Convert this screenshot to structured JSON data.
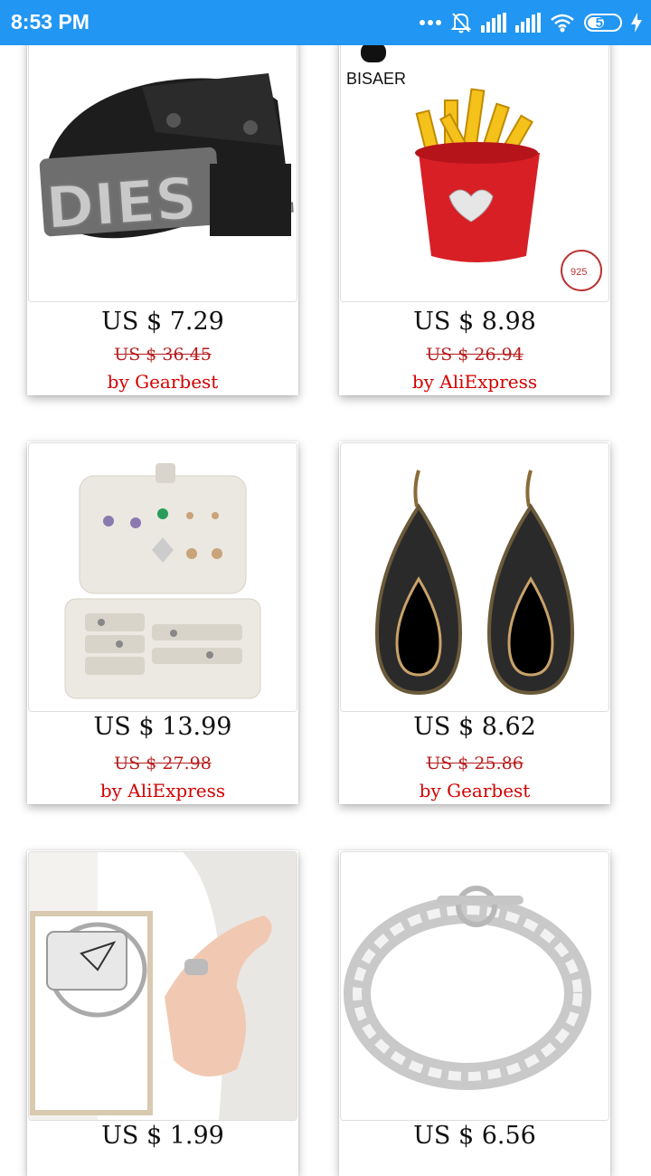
{
  "status_bar": {
    "time": "8:53 PM",
    "battery": "57",
    "battery_level": 0.57,
    "icons": [
      "more-dots-icon",
      "dnd-off-icon",
      "signal-icon",
      "signal-icon",
      "wifi-icon",
      "battery-icon",
      "charging-icon"
    ]
  },
  "products": [
    {
      "price": "US $ 7.29",
      "old_price": "US $ 36.45",
      "seller": "by Gearbest",
      "image": "leather-bracelet-image",
      "image_text": "DIES EL"
    },
    {
      "price": "US $ 8.98",
      "old_price": "US $ 26.94",
      "seller": "by AliExpress",
      "image": "fries-charm-image",
      "image_text": "BISAER"
    },
    {
      "price": "US $ 13.99",
      "old_price": "US $ 27.98",
      "seller": "by AliExpress",
      "image": "jewelry-box-image"
    },
    {
      "price": "US $ 8.62",
      "old_price": "US $ 25.86",
      "seller": "by Gearbest",
      "image": "drop-earrings-image"
    },
    {
      "price": "US $ 1.99",
      "old_price": "",
      "seller": "",
      "image": "paper-plane-ring-image"
    },
    {
      "price": "US $ 6.56",
      "old_price": "",
      "seller": "",
      "image": "silver-chain-bracelet-image"
    }
  ],
  "colors": {
    "status_bar": "#2196F3",
    "price": "#111111",
    "seller": "#d40000",
    "old_price": "#b71c1c"
  }
}
